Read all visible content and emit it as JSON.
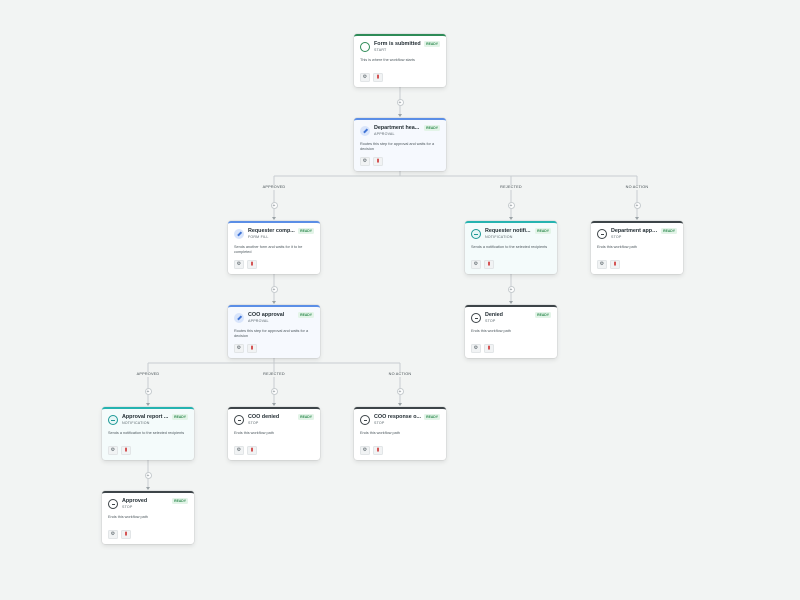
{
  "badge_text": "READY",
  "colors": {
    "background": "#f2f4f3",
    "start_accent": "#2e8b57",
    "approval_accent": "#5b8ee6",
    "notification_accent": "#25b3b0",
    "stop_accent": "#3d4448",
    "ready_badge": "#2d8a4e",
    "delete_icon": "#d24848"
  },
  "icons": {
    "start": "circle-outline-icon",
    "approval": "pencil-icon",
    "form": "pencil-icon",
    "notification": "bell-icon",
    "stop": "stop-circle-icon",
    "settings": "gear-icon",
    "delete": "trash-icon",
    "add": "plus-icon",
    "arrow": "arrow-down-icon"
  },
  "nodes": [
    {
      "id": "n1",
      "type": "start",
      "title": "Form is submitted",
      "subtitle": "START",
      "description": "This is where the workflow starts"
    },
    {
      "id": "n2",
      "type": "approval",
      "title": "Department hea...",
      "subtitle": "APPROVAL",
      "description": "Routes this step for approval and waits for a decision"
    },
    {
      "id": "n3",
      "type": "form",
      "title": "Requester comp...",
      "subtitle": "FORM FILL",
      "description": "Sends another form and waits for it to be completed"
    },
    {
      "id": "n4",
      "type": "notification",
      "title": "Requester notifi...",
      "subtitle": "NOTIFICATION",
      "description": "Sends a notification to the selected recipients"
    },
    {
      "id": "n5",
      "type": "stop",
      "title": "Department appr...",
      "subtitle": "STOP",
      "description": "Ends this workflow path"
    },
    {
      "id": "n6",
      "type": "approval",
      "title": "COO approval",
      "subtitle": "APPROVAL",
      "description": "Routes this step for approval and waits for a decision"
    },
    {
      "id": "n7",
      "type": "stop",
      "title": "Denied",
      "subtitle": "STOP",
      "description": "Ends this workflow path"
    },
    {
      "id": "n8",
      "type": "notification",
      "title": "Approval report ...",
      "subtitle": "NOTIFICATION",
      "description": "Sends a notification to the selected recipients"
    },
    {
      "id": "n9",
      "type": "stop",
      "title": "COO denied",
      "subtitle": "STOP",
      "description": "Ends this workflow path"
    },
    {
      "id": "n10",
      "type": "stop",
      "title": "COO response o...",
      "subtitle": "STOP",
      "description": "Ends this workflow path"
    },
    {
      "id": "n11",
      "type": "stop",
      "title": "Approved",
      "subtitle": "STOP",
      "description": "Ends this workflow path"
    }
  ],
  "branches": [
    {
      "id": "b1",
      "label": "APPROVED"
    },
    {
      "id": "b2",
      "label": "REJECTED"
    },
    {
      "id": "b3",
      "label": "NO ACTION"
    },
    {
      "id": "b4",
      "label": "APPROVED"
    },
    {
      "id": "b5",
      "label": "REJECTED"
    },
    {
      "id": "b6",
      "label": "NO ACTION"
    }
  ]
}
